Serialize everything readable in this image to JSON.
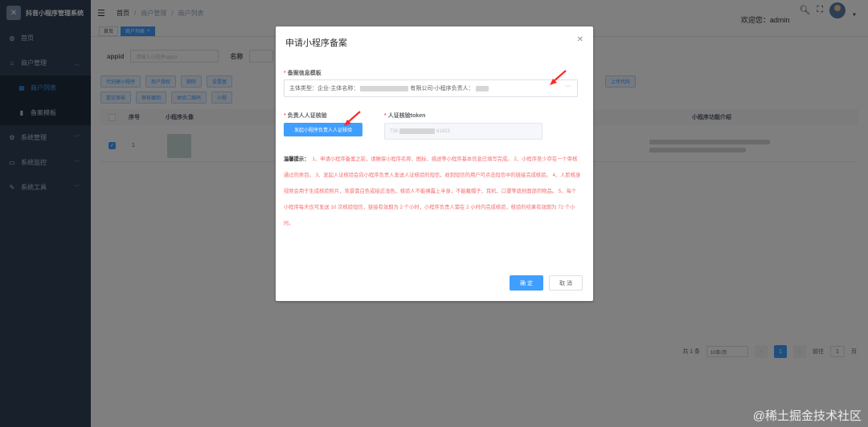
{
  "app": {
    "brand_title": "抖音小程序管理系统"
  },
  "sidebar": {
    "items": [
      {
        "label": "首页",
        "icon": "dashboard-icon"
      },
      {
        "label": "商户管理",
        "icon": "shop-icon"
      },
      {
        "label": "商户列表",
        "icon": "grid-icon"
      },
      {
        "label": "备案模板",
        "icon": "template-icon"
      },
      {
        "label": "系统管理",
        "icon": "gear-icon"
      },
      {
        "label": "系统监控",
        "icon": "monitor-icon"
      },
      {
        "label": "系统工具",
        "icon": "tool-icon"
      }
    ]
  },
  "header": {
    "breadcrumb": [
      "首页",
      "商户管理",
      "商户列表"
    ],
    "welcome": "欢迎您：admin"
  },
  "tags": [
    "首页",
    "商户列表"
  ],
  "search": {
    "appid_label": "appid",
    "appid_placeholder": "请输入小程序appid",
    "name_label": "名称"
  },
  "toolbar": {
    "row1": [
      "代创建小程序",
      "商户授权",
      "删除",
      "设置基"
    ],
    "row1_right": "上传代码",
    "row2": [
      "提交审核",
      "审核撤回",
      "体验二维码",
      "小程"
    ]
  },
  "table": {
    "headers": [
      "序号",
      "小程序头像",
      "小程序功能介绍"
    ],
    "rows": [
      {
        "index": "1"
      }
    ]
  },
  "pagination": {
    "total": "共 1 条",
    "page_size": "10条/页",
    "current_page": "1",
    "goto_label": "前往",
    "goto_value": "1",
    "page_suffix": "页"
  },
  "dialog": {
    "title": "申请小程序备案",
    "template_label": "备案信息模板",
    "template_value_prefix": "主体类型：企业-主体名称：",
    "template_value_mid": "有限公司-小程序负责人：",
    "person_verify_label": "负责人人证核验",
    "verify_button": "发起小程序负责人人证核验",
    "token_label": "人证核验token",
    "token_prefix": "738",
    "token_suffix": "81823",
    "notice_label": "温馨提示：",
    "notice_text": "1、申请小程序备案之前，请确保小程序名称、图标、描述等小程序基本信息已填写完成。 2、小程序至少存在一个审核通过的类目。 3、发起人证核验会向小程序负责人发送人证核验的短信，收到短信的用户可点击短信中的链接完成核验。 4、人脸核身视频会用于生成核验照片，背景需白色或接近浅色，核验人不能裸露上半身，不能戴帽子、耳机、口罩等遮挡面部的物品。 5、每个小程序每天仅可发送 10 次核验短信，链接有效期为 2 个小时，小程序负责人需在 2 小时内完成核验，核验的结果有效期为 72 个小时。",
    "confirm": "确 定",
    "cancel": "取 消"
  },
  "watermark": "@稀土掘金技术社区",
  "colors": {
    "primary": "#409eff",
    "sidebar": "#304156",
    "danger": "#f56c6c"
  }
}
